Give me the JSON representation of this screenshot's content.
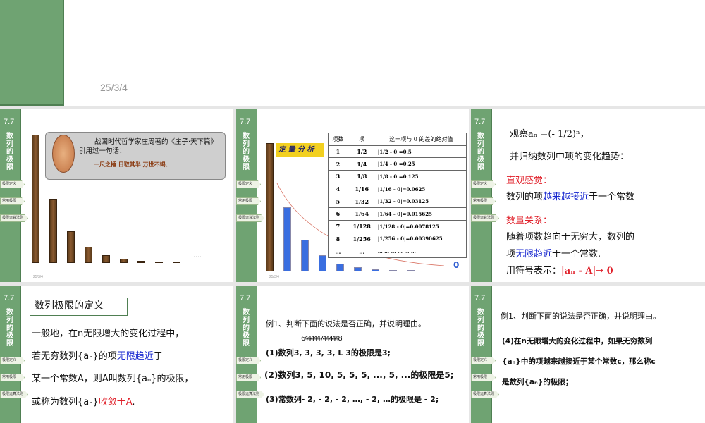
{
  "top_slide": {
    "date": "25/3/4"
  },
  "sidebar": {
    "section": "7.7",
    "title": "数列的极限",
    "tabs": [
      "极限定义",
      "常用极限",
      "极限运算法则"
    ]
  },
  "slide1": {
    "quote_intro": "战国时代哲学家庄周著的《庄子·天下篇》引用过一句话：",
    "quote": "一尺之棰 日取其半 万世不竭．",
    "ellipsis": "……",
    "date": "25/3/4",
    "bar_levels": [
      1,
      0.5,
      0.25,
      0.125,
      0.0625,
      0.03125,
      0.016,
      0.01,
      0.005
    ]
  },
  "slide2": {
    "label": "定 量 分 析",
    "date": "25/3/4",
    "ellipsis": "……",
    "zero": "0",
    "bar_levels": [
      0.5,
      0.25,
      0.125,
      0.0625,
      0.03125,
      0.016,
      0.012,
      0.008
    ],
    "headers": [
      "项数",
      "项",
      "这一项与 0 的差的绝对值"
    ],
    "rows": [
      [
        "1",
        "1/2",
        "|1/2 - 0|=0.5"
      ],
      [
        "2",
        "1/4",
        "|1/4 - 0|=0.25"
      ],
      [
        "3",
        "1/8",
        "|1/8 - 0|=0.125"
      ],
      [
        "4",
        "1/16",
        "|1/16 - 0|=0.0625"
      ],
      [
        "5",
        "1/32",
        "|1/32 - 0|=0.03125"
      ],
      [
        "6",
        "1/64",
        "|1/64 - 0|=0.015625"
      ],
      [
        "7",
        "1/128",
        "|1/128 - 0|=0.0078125"
      ],
      [
        "8",
        "1/256",
        "|1/256 - 0|=0.00390625"
      ],
      [
        "…",
        "…",
        "… … …    … … …"
      ]
    ]
  },
  "slide3": {
    "observe": "观察aₙ =(- 1/2)ⁿ，",
    "induce": "并归纳数列中项的变化趋势：",
    "intuition": "直观感觉：",
    "l1a": "数列的项",
    "l1b": "越来越接近",
    "l1c": "于一个常数",
    "quant": "数量关系：",
    "l2": "随着项数趋向于无穷大，数列的",
    "l3a": "项",
    "l3b": "无限趋近",
    "l3c": "于一个常数.",
    "l4a": "用符号表示：",
    "l4b": "|aₙ - A|→ 0"
  },
  "slide4": {
    "title": "数列极限的定义",
    "p1": "一般地，在n无限增大的变化过程中，",
    "p2a": "若无穷数列{aₙ}的项",
    "p2b": "无限趋近",
    "p2c": "于",
    "p3": "某一个常数A，则A叫数列{aₙ}的极限，",
    "p4a": "或称为数列{aₙ}",
    "p4b": "收敛于A",
    "p4c": "."
  },
  "slide5": {
    "q": "例1、判断下面的说法是否正确，并说明理由。",
    "brace": "6444447444448",
    "s1": "(1)数列3, 3, 3, 3, L  3的极限是3;",
    "s2": "(2)数列3, 5, 10, 5, 5, 5, ..., 5, ...的极限是5;",
    "s3": "(3)常数列- 2, - 2, - 2, …, - 2, …的极限是 - 2;"
  },
  "slide6": {
    "q": "例1、判断下面的说法是否正确，并说明理由。",
    "s4a": "(4)在n无限增大的变化过程中，如果无穷数列",
    "s4b": "{aₙ}中的项越来越接近于某个常数c，那么称c",
    "s4c": "是数列{aₙ}的极限；"
  }
}
